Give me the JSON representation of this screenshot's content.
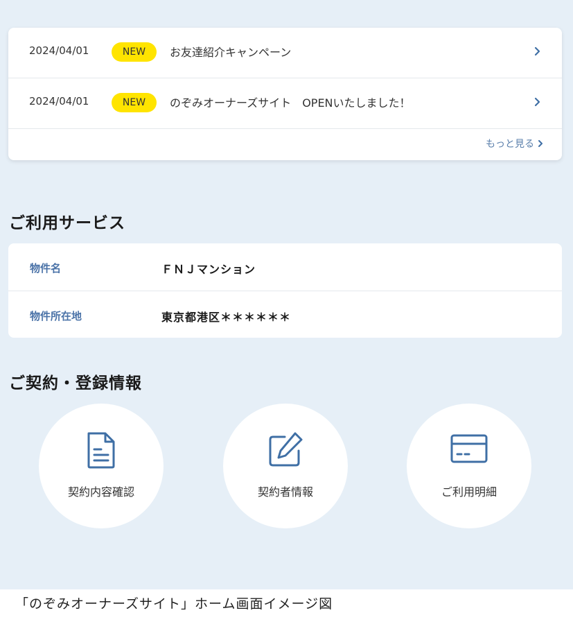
{
  "news": {
    "items": [
      {
        "date": "2024/04/01",
        "badge": "NEW",
        "title": "お友達紹介キャンペーン"
      },
      {
        "date": "2024/04/01",
        "badge": "NEW",
        "title": "のぞみオーナーズサイト　OPENいたしました！"
      }
    ],
    "more_label": "もっと見る"
  },
  "services": {
    "title": "ご利用サービス",
    "rows": [
      {
        "label": "物件名",
        "value": "ＦＮＪマンション"
      },
      {
        "label": "物件所在地",
        "value": "東京都港区＊＊＊＊＊＊"
      }
    ]
  },
  "contract": {
    "title": "ご契約・登録情報",
    "buttons": [
      {
        "label": "契約内容確認",
        "icon": "document-icon"
      },
      {
        "label": "契約者情報",
        "icon": "edit-icon"
      },
      {
        "label": "ご利用明細",
        "icon": "card-icon"
      }
    ]
  },
  "caption": "「のぞみオーナーズサイト」ホーム画面イメージ図",
  "colors": {
    "background": "#e6eff7",
    "badge": "#ffe400",
    "accent": "#4b73a8",
    "icon": "#3f6fa5"
  }
}
